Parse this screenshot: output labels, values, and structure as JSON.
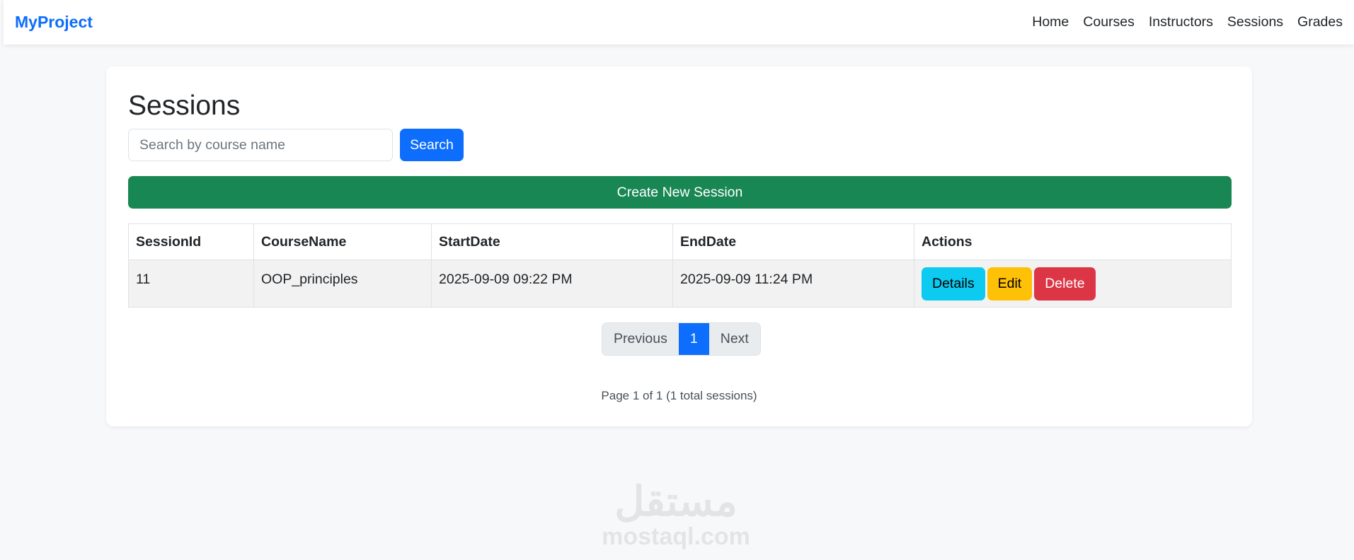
{
  "navbar": {
    "brand": "MyProject",
    "links": [
      "Home",
      "Courses",
      "Instructors",
      "Sessions",
      "Grades"
    ]
  },
  "page": {
    "title": "Sessions",
    "search_placeholder": "Search by course name",
    "search_label": "Search",
    "create_label": "Create New Session"
  },
  "table": {
    "headers": [
      "SessionId",
      "CourseName",
      "StartDate",
      "EndDate",
      "Actions"
    ],
    "rows": [
      {
        "id": "11",
        "course": "OOP_principles",
        "start": "2025-09-09 09:22 PM",
        "end": "2025-09-09 11:24 PM"
      }
    ],
    "actions": {
      "details": "Details",
      "edit": "Edit",
      "delete": "Delete"
    }
  },
  "pagination": {
    "previous": "Previous",
    "current": "1",
    "next": "Next",
    "info": "Page 1 of 1 (1 total sessions)"
  },
  "watermark": {
    "arabic": "مستقل",
    "latin": "mostaql.com"
  }
}
